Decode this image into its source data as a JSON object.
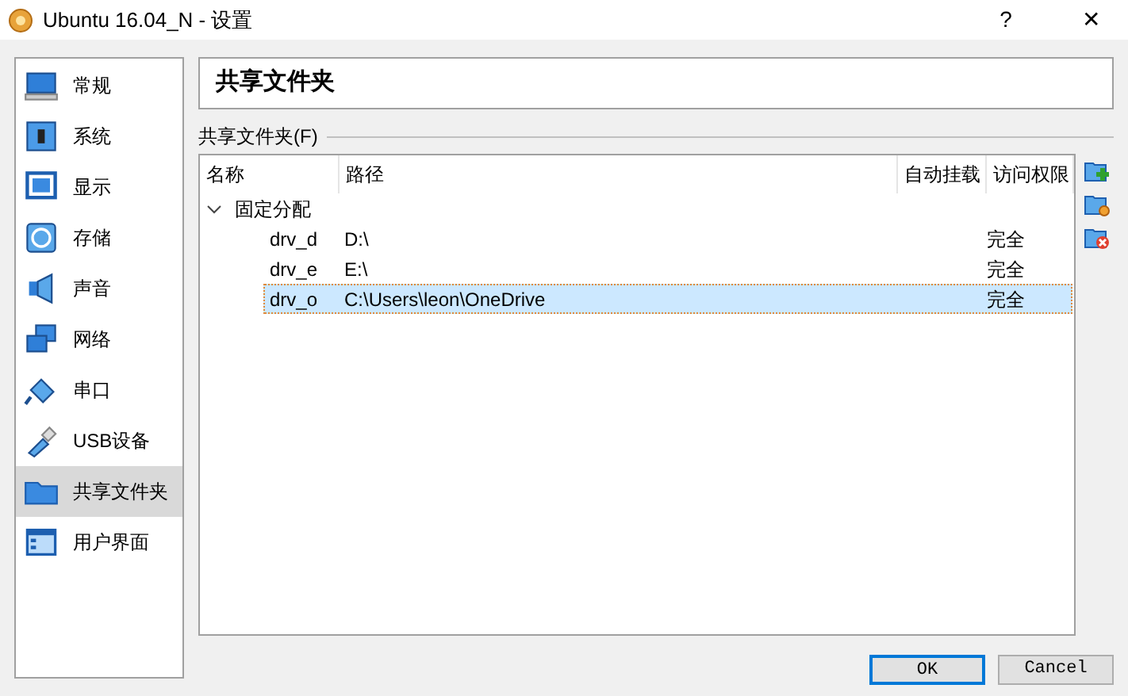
{
  "window": {
    "title": "Ubuntu 16.04_N - 设置",
    "help": "?",
    "close": "✕"
  },
  "sidebar": {
    "items": [
      {
        "label": "常规",
        "selected": false
      },
      {
        "label": "系统",
        "selected": false
      },
      {
        "label": "显示",
        "selected": false
      },
      {
        "label": "存储",
        "selected": false
      },
      {
        "label": "声音",
        "selected": false
      },
      {
        "label": "网络",
        "selected": false
      },
      {
        "label": "串口",
        "selected": false
      },
      {
        "label": "USB设备",
        "selected": false
      },
      {
        "label": "共享文件夹",
        "selected": true
      },
      {
        "label": "用户界面",
        "selected": false
      }
    ]
  },
  "page_title": "共享文件夹",
  "group_label": "共享文件夹(F)",
  "table": {
    "columns": [
      "名称",
      "路径",
      "自动挂载",
      "访问权限"
    ],
    "groups": [
      {
        "label": "固定分配",
        "expanded": true,
        "children": [
          {
            "cells": [
              "drv_d",
              "D:\\",
              "",
              "完全"
            ],
            "selected": false
          },
          {
            "cells": [
              "drv_e",
              "E:\\",
              "",
              "完全"
            ],
            "selected": false
          },
          {
            "cells": [
              "drv_o",
              "C:\\Users\\leon\\OneDrive",
              "",
              "完全"
            ],
            "selected": true
          }
        ]
      }
    ]
  },
  "buttons": [
    "OK",
    "Cancel"
  ]
}
